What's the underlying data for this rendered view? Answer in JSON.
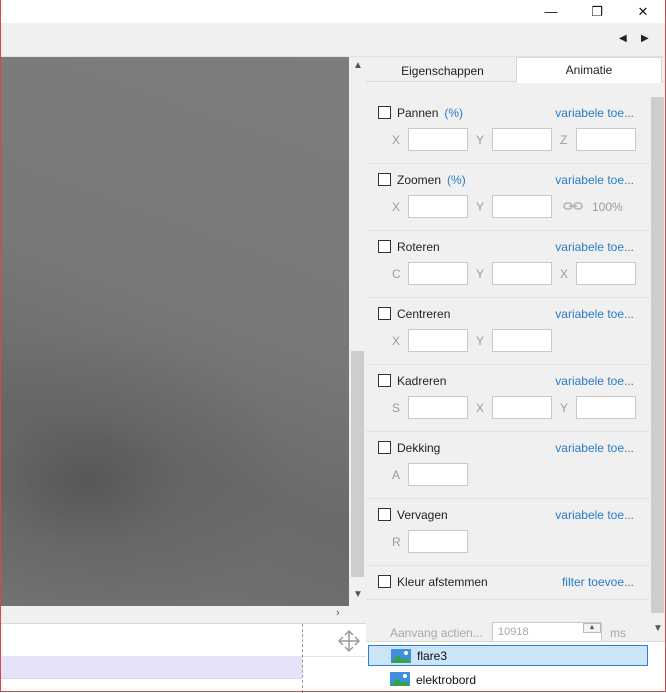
{
  "window": {
    "minimize_glyph": "—",
    "maximize_glyph": "❐",
    "close_glyph": "✕"
  },
  "toolbar": {
    "prev_glyph": "◀",
    "next_glyph": "▶"
  },
  "tabs": [
    {
      "label": "Eigenschappen",
      "active": false
    },
    {
      "label": "Animatie",
      "active": true
    }
  ],
  "sections": [
    {
      "label": "Pannen",
      "unit": "(%)",
      "link": "variabele toe...",
      "fields": [
        "X",
        "Y",
        "Z"
      ],
      "checked": false
    },
    {
      "label": "Zoomen",
      "unit": "(%)",
      "link": "variabele toe...",
      "fields": [
        "X",
        "Y"
      ],
      "extra": "100%",
      "checked": false
    },
    {
      "label": "Roteren",
      "unit": "",
      "link": "variabele toe...",
      "fields": [
        "C",
        "Y",
        "X"
      ],
      "checked": false
    },
    {
      "label": "Centreren",
      "unit": "",
      "link": "variabele toe...",
      "fields": [
        "X",
        "Y"
      ],
      "checked": false
    },
    {
      "label": "Kadreren",
      "unit": "",
      "link": "variabele toe...",
      "fields": [
        "S",
        "X",
        "Y"
      ],
      "checked": false
    },
    {
      "label": "Dekking",
      "unit": "",
      "link": "variabele toe...",
      "fields": [
        "A"
      ],
      "checked": false
    },
    {
      "label": "Vervagen",
      "unit": "",
      "link": "variabele toe...",
      "fields": [
        "R"
      ],
      "checked": false
    },
    {
      "label": "Kleur afstemmen",
      "unit": "",
      "link": "filter toevoe...",
      "fields": [],
      "checked": false
    }
  ],
  "start": {
    "label": "Aanvang actien...",
    "value": "10918",
    "unit": "ms"
  },
  "layers": [
    {
      "name": "flare3",
      "selected": true
    },
    {
      "name": "elektrobord",
      "selected": false
    }
  ],
  "colors": {
    "link": "#2a7bc7",
    "selection": "#cce4f7",
    "timeline_highlight": "#e6e3f8"
  }
}
